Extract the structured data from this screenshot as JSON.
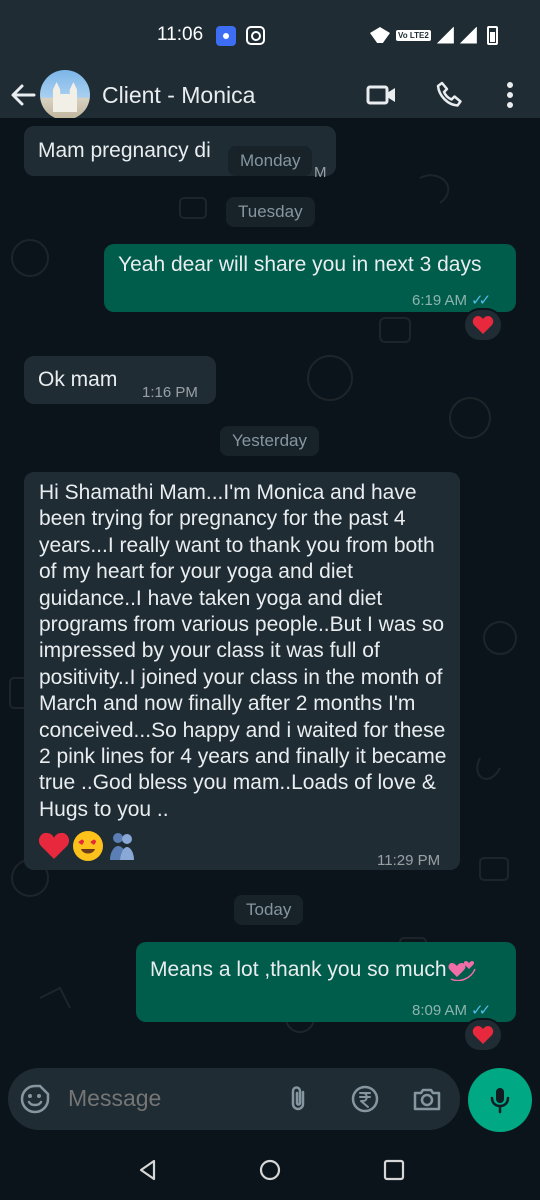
{
  "status_bar": {
    "time": "11:06",
    "network_badge": "Vo LTE2"
  },
  "header": {
    "title": "Client - Monica",
    "icons": [
      "back-arrow-icon",
      "video-call-icon",
      "voice-call-icon",
      "more-options-icon"
    ]
  },
  "messages": [
    {
      "direction": "in",
      "text": "Mam pregnancy di",
      "time": "M"
    },
    {
      "direction": "out",
      "text": "Yeah dear will share you in next 3 days",
      "time": "6:19 AM",
      "reaction": "heart"
    },
    {
      "direction": "in",
      "text": "Ok mam",
      "time": "1:16 PM"
    },
    {
      "direction": "in",
      "text": "Hi Shamathi Mam...I'm Monica and have been trying for pregnancy for the past 4 years...I really want to thank you from both of my heart for your yoga and diet guidance..I have taken yoga and diet programs from various people..But I was so impressed by your class it was full of positivity..I joined your class in the month of March and now finally after 2 months I'm conceived...So happy and i waited for these 2 pink lines for 4 years and finally it became true ..God bless you mam..Loads of love & Hugs to you ..",
      "emojis": [
        "red-heart",
        "heart-eyes-face",
        "hugging-people"
      ],
      "time": "11:29 PM"
    },
    {
      "direction": "out",
      "text": "Means a lot ,thank you so much",
      "emoji": "revolving-hearts",
      "time": "8:09 AM",
      "reaction": "heart"
    }
  ],
  "dates": {
    "d1": "Monday",
    "d2": "Tuesday",
    "d3": "Yesterday",
    "d4": "Today"
  },
  "composer": {
    "placeholder": "Message"
  },
  "colors": {
    "incoming": "#1f2c34",
    "outgoing": "#005c4b",
    "accent": "#00a884",
    "read_ticks": "#53bdeb",
    "background": "#0b141a"
  }
}
